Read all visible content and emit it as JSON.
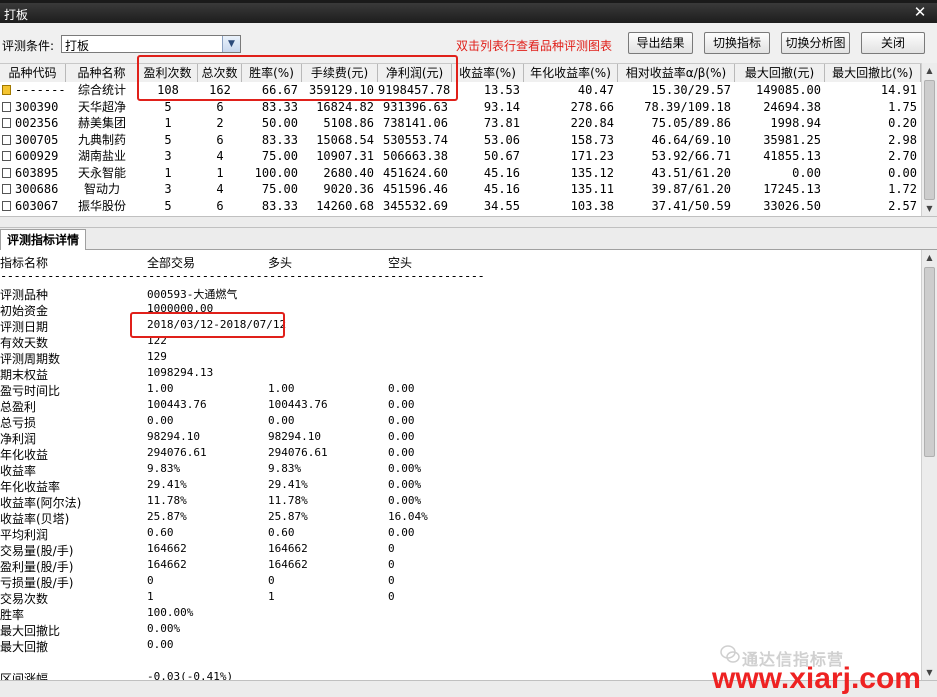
{
  "window": {
    "title": "打板",
    "close_glyph": "✕"
  },
  "toolbar": {
    "condition_label": "评测条件:",
    "condition_value": "打板",
    "hint": "双击列表行查看品种评测图表",
    "buttons": [
      "导出结果",
      "切换指标",
      "切换分析图",
      "关闭"
    ]
  },
  "table": {
    "columns": [
      "品种代码",
      "品种名称",
      "盈利次数",
      "总次数",
      "胜率(%)",
      "手续费(元)",
      "净利润(元)",
      "收益率(%)",
      "年化收益率(%)",
      "相对收益率α/β(%)",
      "最大回撤(元)",
      "最大回撤比(%)"
    ],
    "rows": [
      {
        "code": "-------",
        "name": "综合统计",
        "wins": "108",
        "total": "162",
        "winrate": "66.67",
        "fee": "359129.10",
        "profit": "9198457.78",
        "ret": "13.53",
        "annual": "40.47",
        "ab": "15.30/29.57",
        "maxdd": "149085.00",
        "ddratio": "14.91",
        "icon": "summary-folder-icon"
      },
      {
        "code": "300390",
        "name": "天华超净",
        "wins": "5",
        "total": "6",
        "winrate": "83.33",
        "fee": "16824.82",
        "profit": "931396.63",
        "ret": "93.14",
        "annual": "278.66",
        "ab": "78.39/109.18",
        "maxdd": "24694.38",
        "ddratio": "1.75",
        "icon": "document-icon"
      },
      {
        "code": "002356",
        "name": "赫美集团",
        "wins": "1",
        "total": "2",
        "winrate": "50.00",
        "fee": "5108.86",
        "profit": "738141.06",
        "ret": "73.81",
        "annual": "220.84",
        "ab": "75.05/89.86",
        "maxdd": "1998.94",
        "ddratio": "0.20",
        "icon": "document-icon"
      },
      {
        "code": "300705",
        "name": "九典制药",
        "wins": "5",
        "total": "6",
        "winrate": "83.33",
        "fee": "15068.54",
        "profit": "530553.74",
        "ret": "53.06",
        "annual": "158.73",
        "ab": "46.64/69.10",
        "maxdd": "35981.25",
        "ddratio": "2.98",
        "icon": "document-icon"
      },
      {
        "code": "600929",
        "name": "湖南盐业",
        "wins": "3",
        "total": "4",
        "winrate": "75.00",
        "fee": "10907.31",
        "profit": "506663.38",
        "ret": "50.67",
        "annual": "171.23",
        "ab": "53.92/66.71",
        "maxdd": "41855.13",
        "ddratio": "2.70",
        "icon": "document-icon"
      },
      {
        "code": "603895",
        "name": "天永智能",
        "wins": "1",
        "total": "1",
        "winrate": "100.00",
        "fee": "2680.40",
        "profit": "451624.60",
        "ret": "45.16",
        "annual": "135.12",
        "ab": "43.51/61.20",
        "maxdd": "0.00",
        "ddratio": "0.00",
        "icon": "document-icon"
      },
      {
        "code": "300686",
        "name": "智动力",
        "wins": "3",
        "total": "4",
        "winrate": "75.00",
        "fee": "9020.36",
        "profit": "451596.46",
        "ret": "45.16",
        "annual": "135.11",
        "ab": "39.87/61.20",
        "maxdd": "17245.13",
        "ddratio": "1.72",
        "icon": "document-icon"
      },
      {
        "code": "603067",
        "name": "振华股份",
        "wins": "5",
        "total": "6",
        "winrate": "83.33",
        "fee": "14260.68",
        "profit": "345532.69",
        "ret": "34.55",
        "annual": "103.38",
        "ab": "37.41/50.59",
        "maxdd": "33026.50",
        "ddratio": "2.57",
        "icon": "document-icon"
      }
    ]
  },
  "details": {
    "tab_label": "评测指标详情",
    "headers": [
      "指标名称",
      "全部交易",
      "多头",
      "空头"
    ],
    "rows": [
      [
        "评测品种",
        "000593-大通燃气",
        "",
        ""
      ],
      [
        "初始资金",
        "1000000.00",
        "",
        ""
      ],
      [
        "评测日期",
        "2018/03/12-2018/07/12",
        "",
        ""
      ],
      [
        "有效天数",
        "122",
        "",
        ""
      ],
      [
        "评测周期数",
        "129",
        "",
        ""
      ],
      [
        "期末权益",
        "1098294.13",
        "",
        ""
      ],
      [
        "盈亏时间比",
        "1.00",
        "1.00",
        "0.00"
      ],
      [
        "总盈利",
        "100443.76",
        "100443.76",
        "0.00"
      ],
      [
        "总亏损",
        "0.00",
        "0.00",
        "0.00"
      ],
      [
        "净利润",
        "98294.10",
        "98294.10",
        "0.00"
      ],
      [
        "年化收益",
        "294076.61",
        "294076.61",
        "0.00"
      ],
      [
        "收益率",
        "9.83%",
        "9.83%",
        "0.00%"
      ],
      [
        "年化收益率",
        "29.41%",
        "29.41%",
        "0.00%"
      ],
      [
        "收益率(阿尔法)",
        "11.78%",
        "11.78%",
        "0.00%"
      ],
      [
        "收益率(贝塔)",
        "25.87%",
        "25.87%",
        "16.04%"
      ],
      [
        "平均利润",
        "0.60",
        "0.60",
        "0.00"
      ],
      [
        "交易量(股/手)",
        "164662",
        "164662",
        "0"
      ],
      [
        "盈利量(股/手)",
        "164662",
        "164662",
        "0"
      ],
      [
        "亏损量(股/手)",
        "0",
        "0",
        "0"
      ],
      [
        "交易次数",
        "1",
        "1",
        "0"
      ],
      [
        "胜率",
        "100.00%",
        "",
        ""
      ],
      [
        "最大回撤比",
        "0.00%",
        "",
        ""
      ],
      [
        "最大回撤",
        "0.00",
        "",
        ""
      ],
      [
        "",
        "",
        "",
        ""
      ],
      [
        "区间涨幅",
        "-0.03(-0.41%)",
        "",
        ""
      ]
    ]
  },
  "watermark": {
    "account": "通达信指标营",
    "site": "www.xiarj.com"
  },
  "colors": {
    "highlight": "#e0201a",
    "hint": "#e0201a"
  }
}
